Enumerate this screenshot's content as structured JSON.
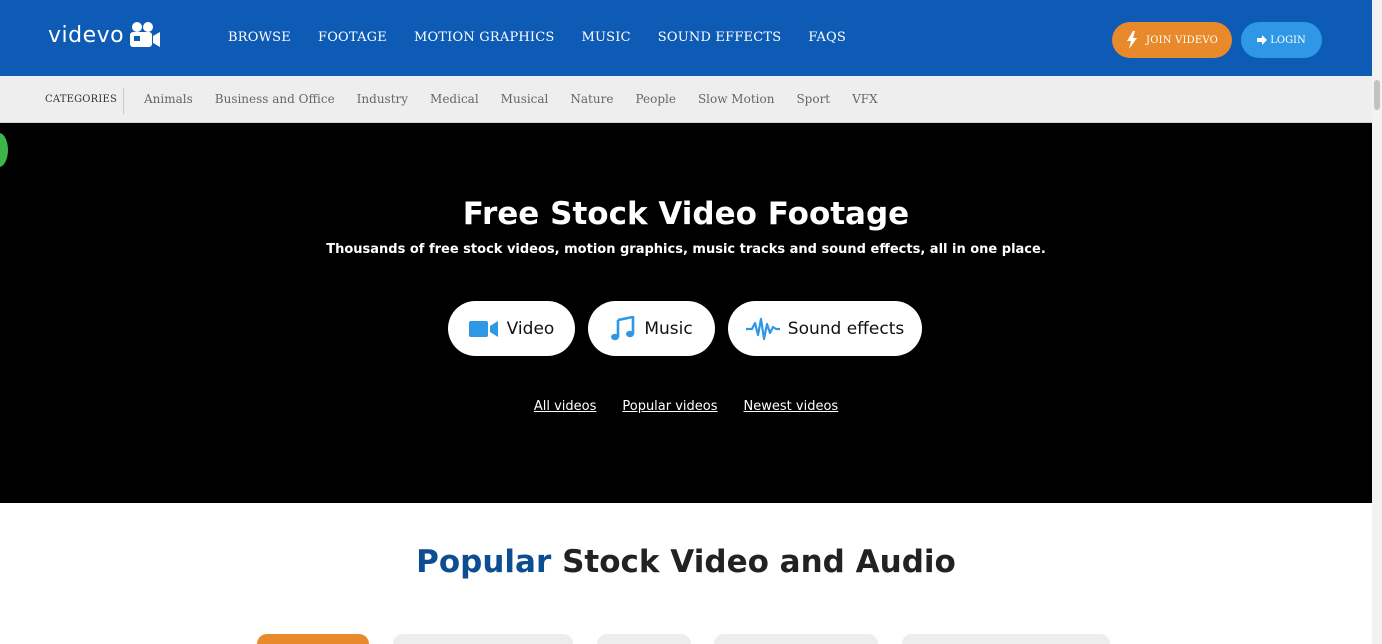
{
  "header": {
    "logo_text": "videvo",
    "nav": [
      {
        "label": "BROWSE"
      },
      {
        "label": "FOOTAGE"
      },
      {
        "label": "MOTION GRAPHICS"
      },
      {
        "label": "MUSIC"
      },
      {
        "label": "SOUND EFFECTS"
      },
      {
        "label": "FAQS"
      }
    ],
    "join_label": "JOIN VIDEVO",
    "login_label": "LOGIN",
    "colors": {
      "bar": "#0d5bb5",
      "join": "#e8892b",
      "login": "#2e97e6"
    }
  },
  "categories": {
    "label": "CATEGORIES",
    "items": [
      "Animals",
      "Business and Office",
      "Industry",
      "Medical",
      "Musical",
      "Nature",
      "People",
      "Slow Motion",
      "Sport",
      "VFX"
    ]
  },
  "hero": {
    "title": "Free Stock Video Footage",
    "subtitle": "Thousands of free stock videos, motion graphics, music tracks and sound effects, all in one place.",
    "pills": [
      {
        "label": "Video",
        "icon": "video-camera-icon"
      },
      {
        "label": "Music",
        "icon": "music-note-icon"
      },
      {
        "label": "Sound effects",
        "icon": "sound-wave-icon"
      }
    ],
    "links": [
      "All videos",
      "Popular videos",
      "Newest videos"
    ],
    "accent_icon_color": "#2e97e6"
  },
  "popular": {
    "accent": "Popular",
    "rest": " Stock Video and Audio"
  }
}
